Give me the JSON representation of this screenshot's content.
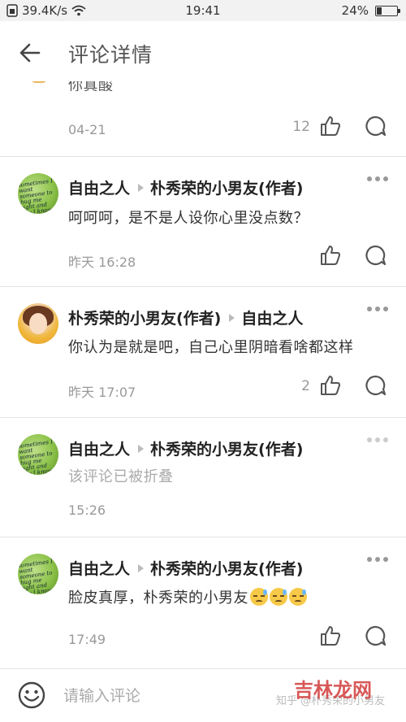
{
  "status_bar": {
    "speed": "39.4K/s",
    "time": "19:41",
    "battery": "24%",
    "battery_level": 0.24
  },
  "header": {
    "title": "评论详情"
  },
  "comments": [
    {
      "partial_text": "你真酸",
      "time": "04-21",
      "likes": "12"
    },
    {
      "author": "自由之人",
      "reply_to": "朴秀荣的小男友(作者)",
      "text": "呵呵呵，是不是人设你心里没点数？",
      "time": "昨天 16:28",
      "likes": ""
    },
    {
      "author": "朴秀荣的小男友(作者)",
      "reply_to": "自由之人",
      "text": "你认为是就是吧，自己心里阴暗看啥都这样",
      "time": "昨天 17:07",
      "likes": "2"
    },
    {
      "author": "自由之人",
      "reply_to": "朴秀荣的小男友(作者)",
      "text": "该评论已被折叠",
      "time": "15:26",
      "likes": ""
    },
    {
      "author": "自由之人",
      "reply_to": "朴秀荣的小男友(作者)",
      "text": "脸皮真厚，朴秀荣的小男友",
      "emoji_count": 3,
      "time": "17:49",
      "likes": ""
    }
  ],
  "avatar_text": "sometimes I want someone to hug me tight and say I know you are not",
  "bottom_bar": {
    "placeholder": "请输入评论",
    "watermark": "知乎 @朴秀荣的小男友",
    "watermark_brand": "吉林龙网"
  },
  "icons": {
    "back": "arrow-left-icon",
    "like": "thumbs-up-icon",
    "reply": "comment-bubble-icon",
    "more": "more-dots-icon",
    "emoji": "smiley-icon"
  }
}
